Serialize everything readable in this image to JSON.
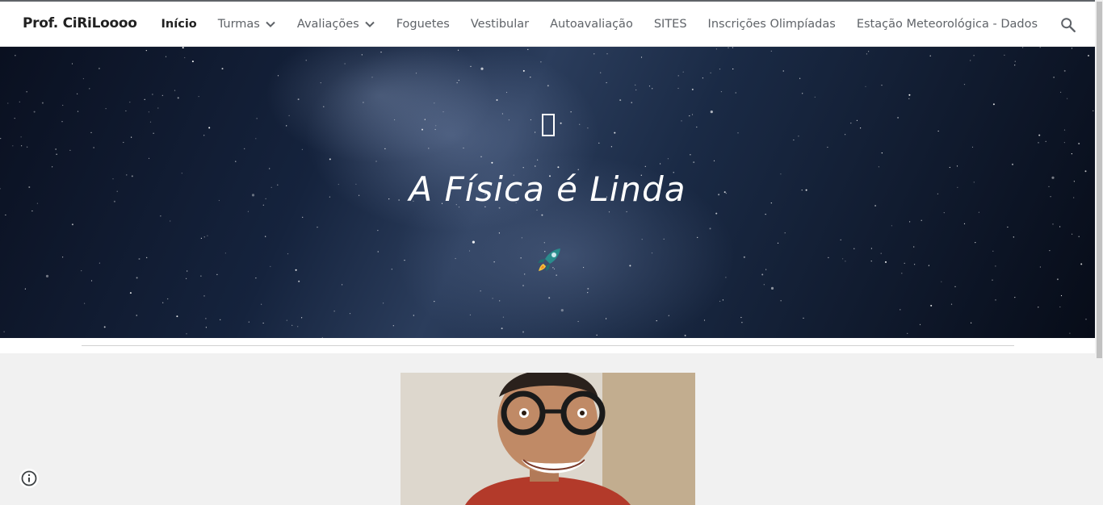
{
  "site": {
    "title": "Prof. CiRiLoooo"
  },
  "nav": {
    "items": [
      {
        "label": "Início",
        "active": true,
        "dropdown": false
      },
      {
        "label": "Turmas",
        "active": false,
        "dropdown": true
      },
      {
        "label": "Avaliações",
        "active": false,
        "dropdown": true
      },
      {
        "label": "Foguetes",
        "active": false,
        "dropdown": false
      },
      {
        "label": "Vestibular",
        "active": false,
        "dropdown": false
      },
      {
        "label": "Autoavaliação",
        "active": false,
        "dropdown": false
      },
      {
        "label": "SITES",
        "active": false,
        "dropdown": false
      },
      {
        "label": "Inscrições Olimpíadas",
        "active": false,
        "dropdown": false
      },
      {
        "label": "Estação Meteorológica - Dados",
        "active": false,
        "dropdown": false
      }
    ],
    "search_icon": "search-icon"
  },
  "hero": {
    "glyph": "missing-glyph-box",
    "title": "A Física é Linda",
    "emoji": "rocket-icon"
  },
  "footer": {
    "info_icon": "info-icon"
  },
  "colors": {
    "nav_text": "#5f6368",
    "nav_active": "#212121",
    "page_bg": "#f1f1f1"
  }
}
